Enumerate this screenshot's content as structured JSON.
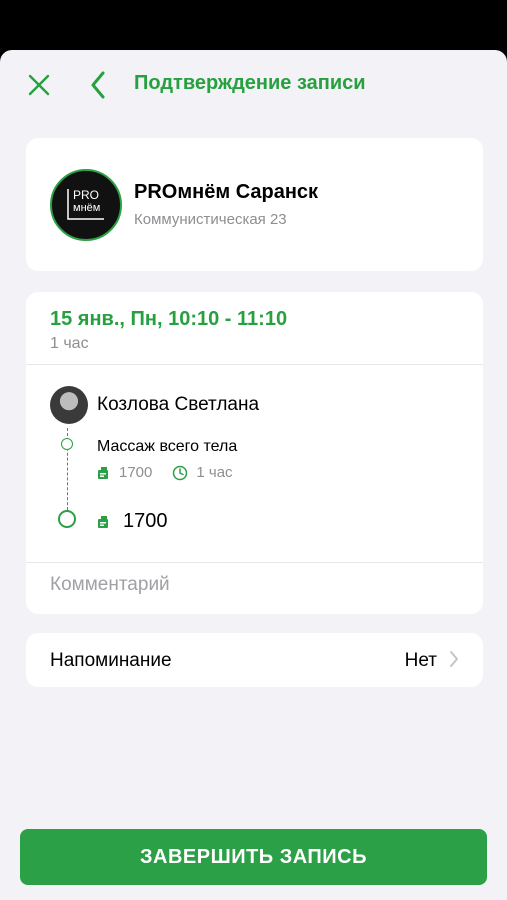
{
  "header": {
    "title": "Подтверждение записи",
    "accent_color": "#27a03f"
  },
  "salon": {
    "name": "PROмнём Саранск",
    "address": "Коммунистическая 23",
    "logo_text_top": "PRO",
    "logo_text_bottom": "мнём"
  },
  "booking": {
    "date_time": "15 янв., Пн, 10:10 - 11:10",
    "duration": "1 час",
    "master": {
      "name": "Козлова Светлана"
    },
    "services": [
      {
        "name": "Массаж всего тела",
        "price": "1700",
        "duration": "1 час"
      }
    ],
    "total": "1700",
    "comment_placeholder": "Комментарий"
  },
  "reminder": {
    "label": "Напоминание",
    "value": "Нет"
  },
  "cta": {
    "label": "ЗАВЕРШИТЬ ЗАПИСЬ",
    "color": "#2ba046"
  },
  "icons": {
    "close": "close-icon",
    "back": "chevron-left-icon",
    "price": "price-tag-icon",
    "duration": "clock-icon",
    "reminder": "chevron-right-icon"
  }
}
